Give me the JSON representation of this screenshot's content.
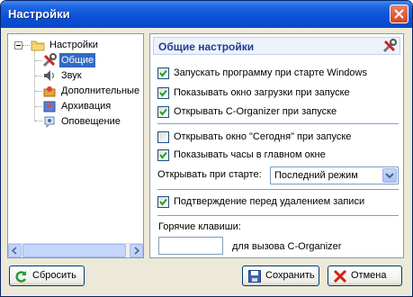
{
  "window": {
    "title": "Настройки"
  },
  "tree": {
    "root": {
      "label": "Настройки",
      "icon": "folder-icon"
    },
    "items": [
      {
        "label": "Общие",
        "icon": "tools-icon",
        "selected": true
      },
      {
        "label": "Звук",
        "icon": "speaker-icon"
      },
      {
        "label": "Дополнительные",
        "icon": "extra-icon"
      },
      {
        "label": "Архивация",
        "icon": "archive-icon"
      },
      {
        "label": "Оповещение",
        "icon": "notification-icon"
      }
    ]
  },
  "panel": {
    "title": "Общие настройки",
    "options": [
      {
        "label": "Запускать программу при старте Windows",
        "checked": true
      },
      {
        "label": "Показывать окно загрузки при запуске",
        "checked": true
      },
      {
        "label": "Открывать C-Organizer при запуске",
        "checked": true
      },
      {
        "label": "Открывать окно \"Сегодня\" при запуске",
        "checked": false
      },
      {
        "label": "Показывать часы в главном окне",
        "checked": true
      },
      {
        "label": "Подтверждение перед удалением записи",
        "checked": true
      }
    ],
    "startup_label": "Открывать при старте:",
    "startup_value": "Последний режим",
    "hotkeys_label": "Горячие клавиши:",
    "hotkey_value": "",
    "hotkey_desc": "для вызова C-Organizer"
  },
  "buttons": {
    "reset": "Сбросить",
    "save": "Сохранить",
    "cancel": "Отмена"
  },
  "colors": {
    "titlebar": "#0b50d8",
    "selection": "#316ac5",
    "panel_title": "#1b3f95",
    "separator": "#7aa0d4"
  }
}
